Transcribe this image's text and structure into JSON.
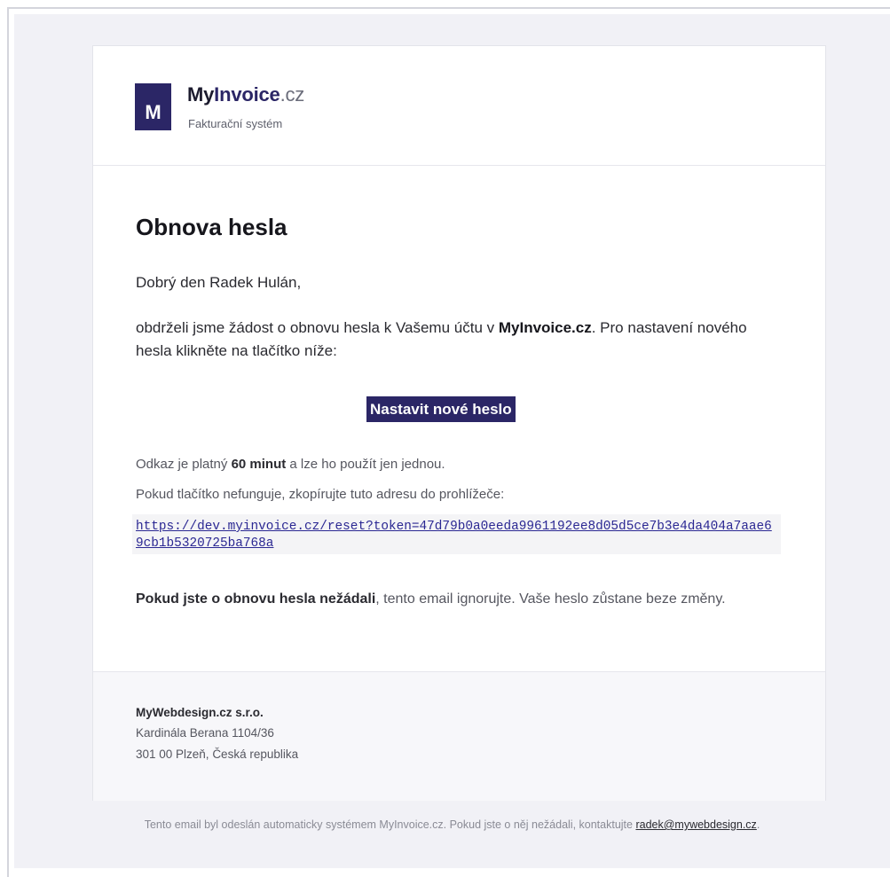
{
  "header": {
    "logo_letter": "M",
    "brand_part1": "My",
    "brand_part2": "Invoice",
    "brand_part3": ".cz",
    "tagline": "Fakturační systém"
  },
  "content": {
    "title": "Obnova hesla",
    "greeting": "Dobrý den Radek Hulán,",
    "paragraph_prefix": "obdrželi jsme žádost o obnovu hesla k Vašemu účtu v ",
    "paragraph_brand": "MyInvoice.cz",
    "paragraph_suffix": ". Pro nastavení nového hesla klikněte na tlačítko níže:",
    "button_label": "Nastavit nové heslo",
    "validity_prefix": "Odkaz je platný ",
    "validity_bold": "60 minut",
    "validity_suffix": " a lze ho použít jen jednou.",
    "fallback_text": "Pokud tlačítko nefunguje, zkopírujte tuto adresu do prohlížeče:",
    "reset_url": "https://dev.myinvoice.cz/reset?token=47d79b0a0eeda9961192ee8d05d5ce7b3e4da404a7aae69cb1b5320725ba768a",
    "warning_bold": "Pokud jste o obnovu hesla nežádali",
    "warning_text": ", tento email ignorujte. Vaše heslo zůstane beze změny."
  },
  "footer": {
    "company": "MyWebdesign.cz s.r.o.",
    "address_line1": "Kardinála Berana 1104/36",
    "address_line2": "301 00 Plzeň, Česká republika"
  },
  "bottom": {
    "text": "Tento email byl odeslán automaticky systémem MyInvoice.cz. Pokud jste o něj nežádali, kontaktujte ",
    "email": "radek@mywebdesign.cz",
    "end": "."
  },
  "colors": {
    "brand": "#2b2666",
    "background": "#f1f1f6",
    "link": "#2b2893"
  }
}
